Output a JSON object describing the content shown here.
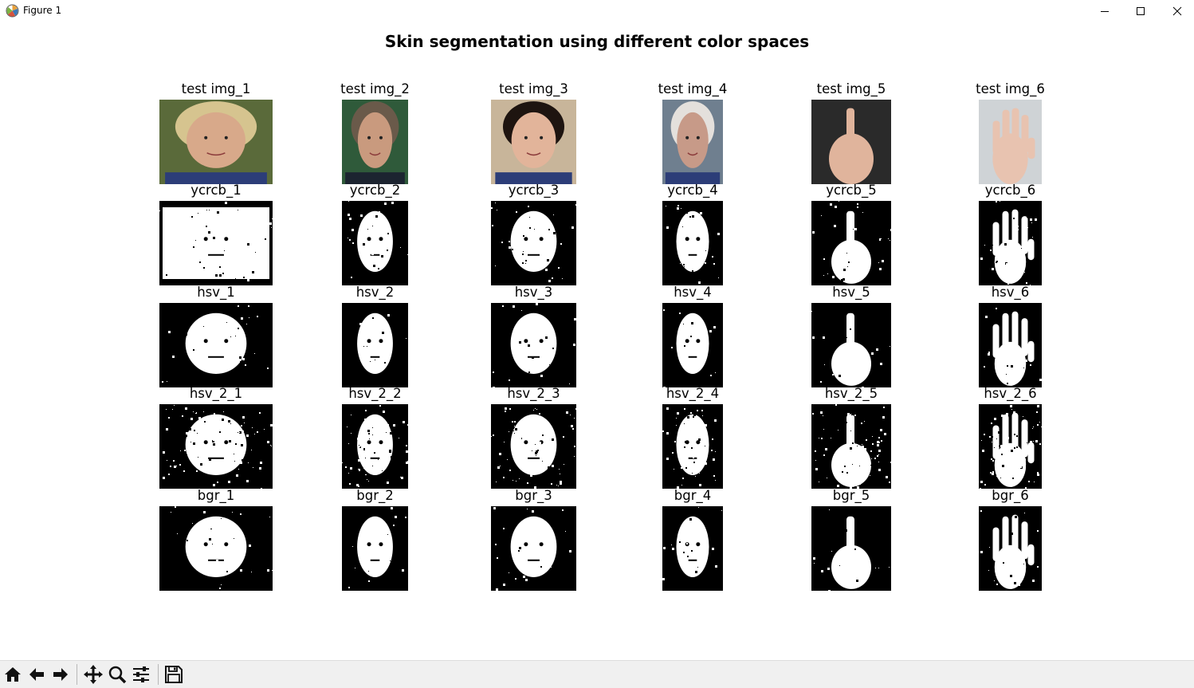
{
  "window": {
    "title": "Figure 1",
    "app_icon": "matplotlib-logo-icon",
    "controls": [
      "minimize-icon",
      "maximize-icon",
      "close-icon"
    ]
  },
  "figure": {
    "suptitle": "Skin segmentation using different color spaces",
    "rows": [
      {
        "kind": "photo",
        "labels": [
          "test img_1",
          "test img_2",
          "test img_3",
          "test img_4",
          "test img_5",
          "test img_6"
        ]
      },
      {
        "kind": "mask",
        "labels": [
          "ycrcb_1",
          "ycrcb_2",
          "ycrcb_3",
          "ycrcb_4",
          "ycrcb_5",
          "ycrcb_6"
        ]
      },
      {
        "kind": "mask",
        "labels": [
          "hsv_1",
          "hsv_2",
          "hsv_3",
          "hsv_4",
          "hsv_5",
          "hsv_6"
        ]
      },
      {
        "kind": "mask",
        "labels": [
          "hsv_2_1",
          "hsv_2_2",
          "hsv_2_3",
          "hsv_2_4",
          "hsv_2_5",
          "hsv_2_6"
        ]
      },
      {
        "kind": "mask",
        "labels": [
          "bgr_1",
          "bgr_2",
          "bgr_3",
          "bgr_4",
          "bgr_5",
          "bgr_6"
        ]
      }
    ]
  },
  "toolbar": {
    "buttons": [
      "home-icon",
      "back-arrow-icon",
      "forward-arrow-icon",
      "pan-move-icon",
      "zoom-magnifier-icon",
      "configure-subplots-icon",
      "save-floppy-icon"
    ]
  },
  "colors": {
    "mask_bg": "#000000",
    "mask_fg": "#ffffff",
    "toolbar_bg": "#f0f0f0"
  }
}
